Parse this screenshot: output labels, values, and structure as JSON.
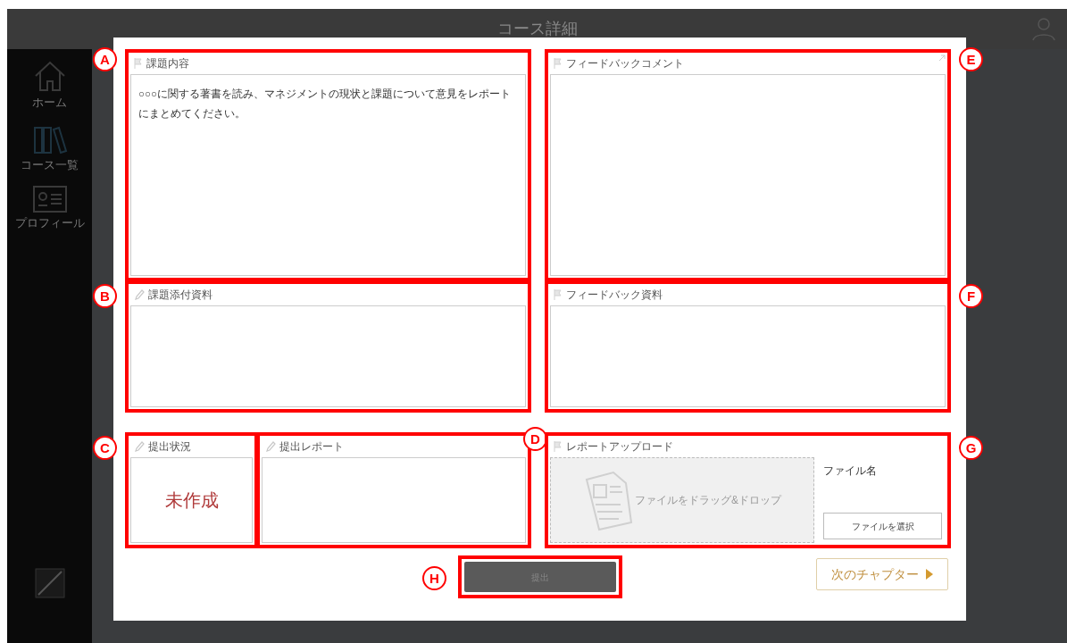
{
  "top_bar": {
    "title": "コース詳細"
  },
  "sidebar": {
    "items": [
      {
        "kind": "home",
        "label": "ホーム"
      },
      {
        "kind": "books",
        "label": "コース一覧"
      },
      {
        "kind": "profile",
        "label": "プロフィール"
      }
    ]
  },
  "modal": {
    "assignment": {
      "callout": "A",
      "kind": "flag",
      "label": "課題内容",
      "content": "○○○に関する著書を読み、マネジメントの現状と課題について意見をレポートにまとめてください。"
    },
    "attachment": {
      "callout": "B",
      "kind": "pencil",
      "label": "課題添付資料"
    },
    "status": {
      "callout": "C",
      "kind": "pencil",
      "label": "提出状況",
      "value": "未作成"
    },
    "report": {
      "callout": "D",
      "kind": "pencil",
      "label": "提出レポート"
    },
    "feedback_comment": {
      "callout": "E",
      "kind": "flag",
      "label": "フィードバックコメント"
    },
    "feedback_material": {
      "callout": "F",
      "kind": "flag",
      "label": "フィードバック資料"
    },
    "upload": {
      "callout": "G",
      "kind": "flag",
      "label": "レポートアップロード",
      "drop_text": "ファイルをドラッグ&ドロップ",
      "file_label": "ファイル名",
      "choose_button": "ファイルを選択"
    },
    "submit_button": {
      "callout": "H",
      "label": "提出",
      "disabled": true
    },
    "next_button": {
      "label": "次のチャプター"
    }
  }
}
